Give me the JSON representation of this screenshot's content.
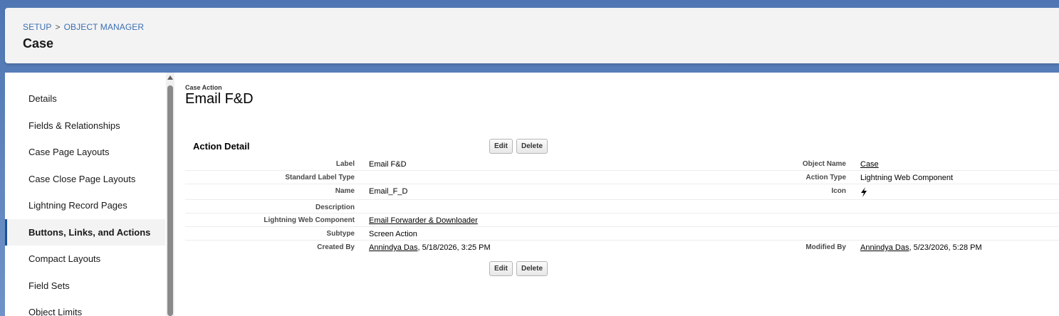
{
  "breadcrumb": {
    "setup": "SETUP",
    "separator": ">",
    "object_manager": "OBJECT MANAGER"
  },
  "page_title": "Case",
  "sidebar": {
    "items": [
      {
        "label": "Details"
      },
      {
        "label": "Fields & Relationships"
      },
      {
        "label": "Case Page Layouts"
      },
      {
        "label": "Case Close Page Layouts"
      },
      {
        "label": "Lightning Record Pages"
      },
      {
        "label": "Buttons, Links, and Actions",
        "active": true
      },
      {
        "label": "Compact Layouts"
      },
      {
        "label": "Field Sets"
      },
      {
        "label": "Object Limits"
      }
    ]
  },
  "detail": {
    "object_type": "Case Action",
    "object_name": "Email F&D",
    "section_title": "Action Detail",
    "edit_label": "Edit",
    "delete_label": "Delete",
    "fields": {
      "label": {
        "label": "Label",
        "value": "Email F&D"
      },
      "standard_label_type": {
        "label": "Standard Label Type",
        "value": ""
      },
      "name": {
        "label": "Name",
        "value": "Email_F_D"
      },
      "description": {
        "label": "Description",
        "value": ""
      },
      "lwc": {
        "label": "Lightning Web Component",
        "value": "Email Forwarder & Downloader"
      },
      "subtype": {
        "label": "Subtype",
        "value": "Screen Action"
      },
      "created_by": {
        "label": "Created By",
        "user": "Annindya Das",
        "date": ", 5/18/2026, 3:25 PM"
      },
      "object_name": {
        "label": "Object Name",
        "value": "Case"
      },
      "action_type": {
        "label": "Action Type",
        "value": "Lightning Web Component"
      },
      "icon": {
        "label": "Icon",
        "icon": "lightning-bolt-icon"
      },
      "modified_by": {
        "label": "Modified By",
        "user": "Annindya Das",
        "date": ", 5/23/2026, 5:28 PM"
      }
    }
  }
}
